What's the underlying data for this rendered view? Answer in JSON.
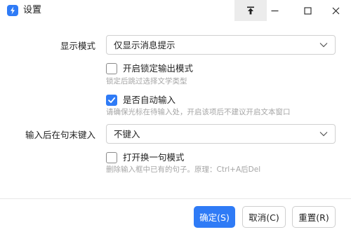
{
  "window": {
    "title": "设置",
    "icons": {
      "app": "lightning-bolt-icon",
      "pin": "pin-to-top-icon",
      "minimize": "minimize-icon",
      "maximize": "maximize-icon",
      "close": "close-icon"
    }
  },
  "display_mode": {
    "label": "显示模式",
    "selected": "仅显示消息提示"
  },
  "lock_output": {
    "label": "开启锁定输出模式",
    "checked": false,
    "hint": "锁定后跳过选择文学类型"
  },
  "auto_input": {
    "label": "是否自动输入",
    "checked": true,
    "hint": "请确保光标在待输入处，开启该项后不建议开启文本窗口"
  },
  "end_key": {
    "label": "输入后在句末键入",
    "selected": "不键入"
  },
  "sentence_mode": {
    "label": "打开换一句模式",
    "checked": false,
    "hint": "删除输入框中已有的句子。原理：Ctrl+A后Del"
  },
  "buttons": {
    "ok": "确定(S)",
    "cancel": "取消(C)",
    "reset": "重置(R)"
  },
  "colors": {
    "accent": "#2f7bf6",
    "hint": "#a6a6a6",
    "border": "#d0d0d0"
  }
}
